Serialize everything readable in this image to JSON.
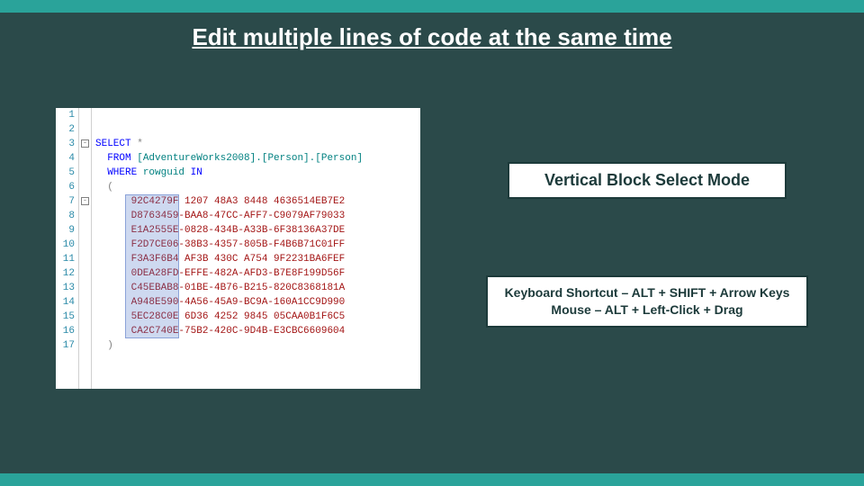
{
  "title": "Edit multiple lines of code at the same time",
  "callout1": "Vertical Block Select Mode",
  "callout2_line1": "Keyboard Shortcut – ALT + SHIFT + Arrow Keys",
  "callout2_line2": "Mouse – ALT + Left-Click + Drag",
  "editor": {
    "line_count": 17,
    "sql": {
      "select": "SELECT",
      "star": "*",
      "from": "FROM",
      "obj": "[AdventureWorks2008].[Person].[Person]",
      "where": "WHERE",
      "col": "rowguid",
      "in": "IN",
      "open_paren": "(",
      "close_paren": ")"
    },
    "guids": [
      "92C4279F 1207 48A3 8448 4636514EB7E2",
      "D8763459-BAA8-47CC-AFF7-C9079AF79033",
      "E1A2555E-0828-434B-A33B-6F38136A37DE",
      "F2D7CE06-38B3-4357-805B-F4B6B71C01FF",
      "F3A3F6B4 AF3B 430C A754 9F2231BA6FEF",
      "0DEA28FD-EFFE-482A-AFD3-B7E8F199D56F",
      "C45EBAB8-01BE-4B76-B215-820C8368181A",
      "A948E590-4A56-45A9-BC9A-160A1CC9D990",
      "5EC28C0E 6D36 4252 9845 05CAA0B1F6C5",
      "CA2C740E-75B2-420C-9D4B-E3CBC6609604"
    ]
  }
}
